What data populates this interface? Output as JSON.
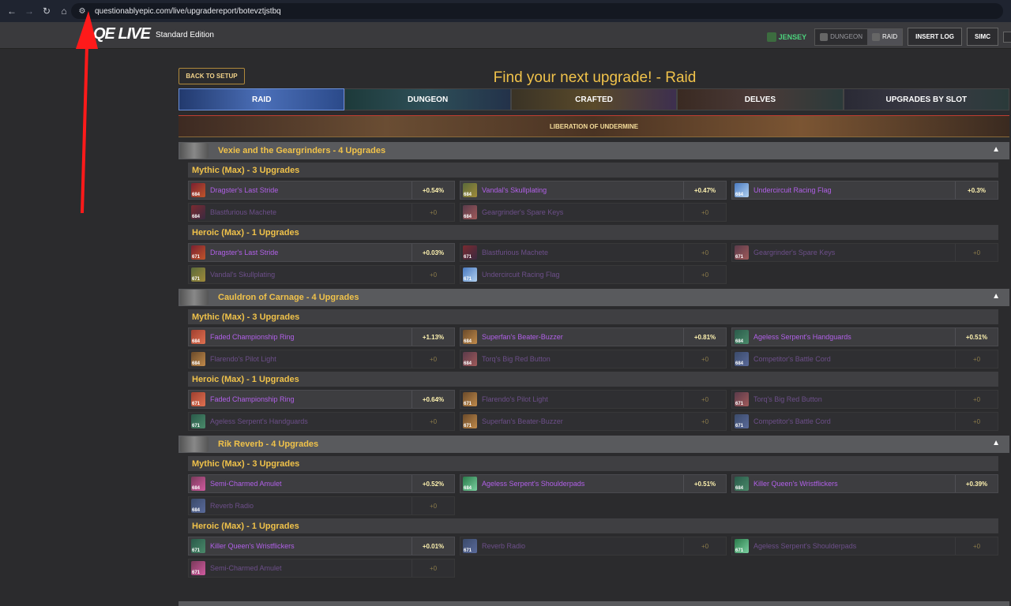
{
  "browser": {
    "url": "questionablyepic.com/live/upgradereport/botevztjstbq"
  },
  "header": {
    "logo": "QE LIVE",
    "edition": "Standard Edition",
    "character": "JENSEY",
    "content_modes": [
      "DUNGEON",
      "RAID"
    ],
    "active_mode": "RAID",
    "insert_log": "INSERT LOG",
    "simc": "SIMC"
  },
  "page": {
    "back_button": "BACK TO SETUP",
    "title": "Find your next upgrade! - Raid"
  },
  "tabs": [
    "RAID",
    "DUNGEON",
    "CRAFTED",
    "DELVES",
    "UPGRADES BY SLOT"
  ],
  "active_tab": "RAID",
  "raid_banner": "LIBERATION OF UNDERMINE",
  "bosses": [
    {
      "title": "Vexie and the Geargrinders - 4 Upgrades",
      "difficulties": [
        {
          "label": "Mythic (Max) - 3 Upgrades",
          "rows": [
            [
              {
                "name": "Dragster's Last Stride",
                "ilvl": "684",
                "pct": "+0.54%"
              },
              {
                "name": "Vandal's Skullplating",
                "ilvl": "684",
                "pct": "+0.47%"
              },
              {
                "name": "Undercircuit Racing Flag",
                "ilvl": "684",
                "pct": "+0.3%"
              }
            ],
            [
              {
                "name": "Blastfurious Machete",
                "ilvl": "684",
                "pct": "+0"
              },
              {
                "name": "Geargrinder's Spare Keys",
                "ilvl": "684",
                "pct": "+0"
              }
            ]
          ]
        },
        {
          "label": "Heroic (Max) - 1 Upgrades",
          "rows": [
            [
              {
                "name": "Dragster's Last Stride",
                "ilvl": "671",
                "pct": "+0.03%"
              },
              {
                "name": "Blastfurious Machete",
                "ilvl": "671",
                "pct": "+0"
              },
              {
                "name": "Geargrinder's Spare Keys",
                "ilvl": "671",
                "pct": "+0"
              }
            ],
            [
              {
                "name": "Vandal's Skullplating",
                "ilvl": "671",
                "pct": "+0"
              },
              {
                "name": "Undercircuit Racing Flag",
                "ilvl": "671",
                "pct": "+0"
              }
            ]
          ]
        }
      ]
    },
    {
      "title": "Cauldron of Carnage - 4 Upgrades",
      "difficulties": [
        {
          "label": "Mythic (Max) - 3 Upgrades",
          "rows": [
            [
              {
                "name": "Faded Championship Ring",
                "ilvl": "684",
                "pct": "+1.13%"
              },
              {
                "name": "Superfan's Beater-Buzzer",
                "ilvl": "684",
                "pct": "+0.81%"
              },
              {
                "name": "Ageless Serpent's Handguards",
                "ilvl": "684",
                "pct": "+0.51%"
              }
            ],
            [
              {
                "name": "Flarendo's Pilot Light",
                "ilvl": "684",
                "pct": "+0"
              },
              {
                "name": "Torq's Big Red Button",
                "ilvl": "684",
                "pct": "+0"
              },
              {
                "name": "Competitor's Battle Cord",
                "ilvl": "684",
                "pct": "+0"
              }
            ]
          ]
        },
        {
          "label": "Heroic (Max) - 1 Upgrades",
          "rows": [
            [
              {
                "name": "Faded Championship Ring",
                "ilvl": "671",
                "pct": "+0.64%"
              },
              {
                "name": "Flarendo's Pilot Light",
                "ilvl": "671",
                "pct": "+0"
              },
              {
                "name": "Torq's Big Red Button",
                "ilvl": "671",
                "pct": "+0"
              }
            ],
            [
              {
                "name": "Ageless Serpent's Handguards",
                "ilvl": "671",
                "pct": "+0"
              },
              {
                "name": "Superfan's Beater-Buzzer",
                "ilvl": "671",
                "pct": "+0"
              },
              {
                "name": "Competitor's Battle Cord",
                "ilvl": "671",
                "pct": "+0"
              }
            ]
          ]
        }
      ]
    },
    {
      "title": "Rik Reverb - 4 Upgrades",
      "difficulties": [
        {
          "label": "Mythic (Max) - 3 Upgrades",
          "rows": [
            [
              {
                "name": "Semi-Charmed Amulet",
                "ilvl": "684",
                "pct": "+0.52%"
              },
              {
                "name": "Ageless Serpent's Shoulderpads",
                "ilvl": "684",
                "pct": "+0.51%"
              },
              {
                "name": "Killer Queen's Wristflickers",
                "ilvl": "684",
                "pct": "+0.39%"
              }
            ],
            [
              {
                "name": "Reverb Radio",
                "ilvl": "684",
                "pct": "+0"
              }
            ]
          ]
        },
        {
          "label": "Heroic (Max) - 1 Upgrades",
          "rows": [
            [
              {
                "name": "Killer Queen's Wristflickers",
                "ilvl": "671",
                "pct": "+0.01%"
              },
              {
                "name": "Reverb Radio",
                "ilvl": "671",
                "pct": "+0"
              },
              {
                "name": "Ageless Serpent's Shoulderpads",
                "ilvl": "671",
                "pct": "+0"
              }
            ],
            [
              {
                "name": "Semi-Charmed Amulet",
                "ilvl": "671",
                "pct": "+0"
              }
            ]
          ]
        }
      ]
    }
  ],
  "colors": {
    "accent_gold": "#f0c24a",
    "epic_purple": "#b160e8",
    "positive_upgrade": "#fff3b0",
    "annotation_arrow": "#ff1a1a"
  }
}
